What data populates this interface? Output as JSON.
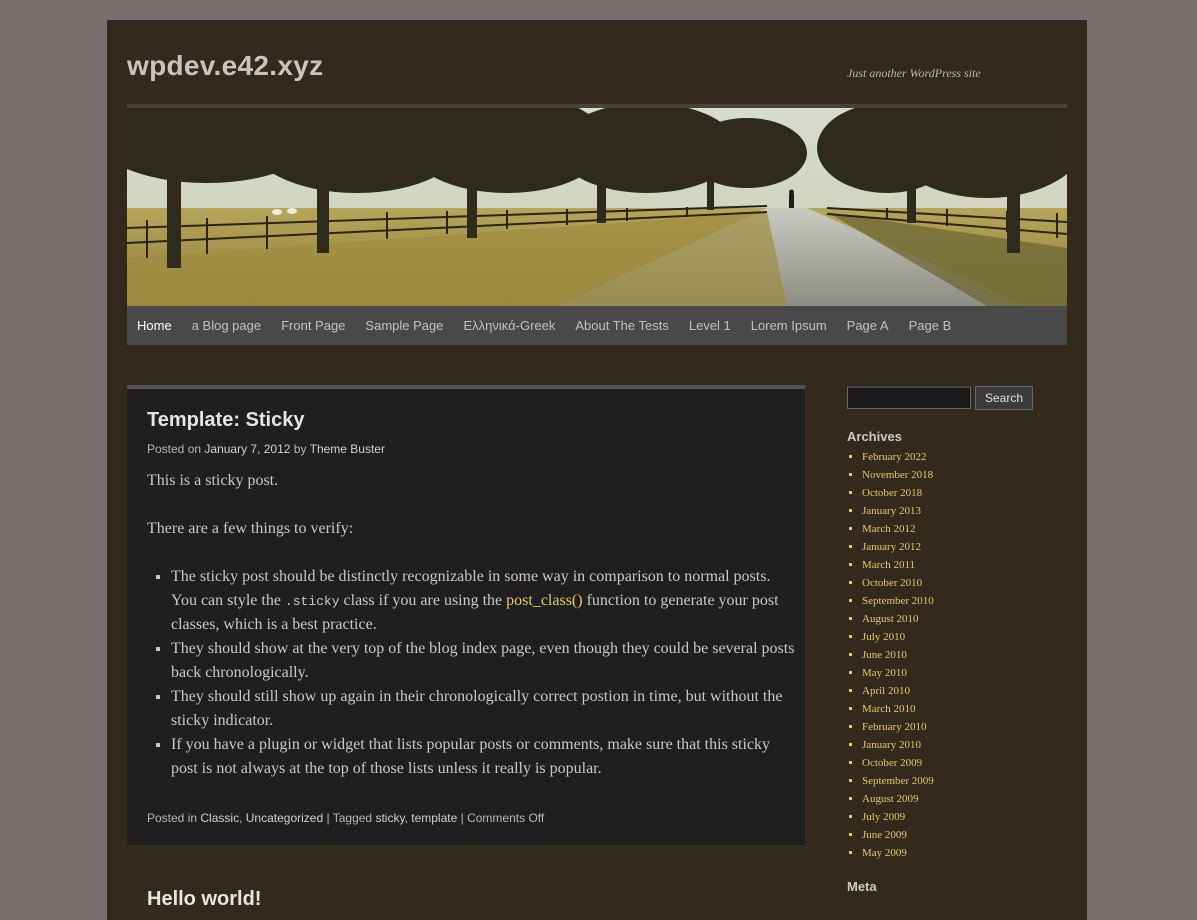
{
  "site": {
    "title": "wpdev.e42.xyz",
    "description": "Just another WordPress site"
  },
  "menu": [
    {
      "label": "Home",
      "current": true
    },
    {
      "label": "a Blog page"
    },
    {
      "label": "Front Page"
    },
    {
      "label": "Sample Page"
    },
    {
      "label": "Ελληνικά-Greek"
    },
    {
      "label": "About The Tests"
    },
    {
      "label": "Level 1"
    },
    {
      "label": "Lorem Ipsum"
    },
    {
      "label": "Page A"
    },
    {
      "label": "Page B"
    }
  ],
  "post": {
    "title": "Template: Sticky",
    "meta": {
      "posted_on": "Posted on",
      "date": "January 7, 2012",
      "by": "by",
      "author": "Theme Buster"
    },
    "paragraphs": [
      "This is a sticky post.",
      "There are a few things to verify:"
    ],
    "list": {
      "item1_a": "The sticky post should be distinctly recognizable in some way in comparison to normal posts. You can style the",
      "item1_code": ".sticky",
      "item1_b": "class if you are using the",
      "item1_link": "post_class()",
      "item1_c": "function to generate your post classes, which is a best practice.",
      "item2": "They should show at the very top of the blog index page, even though they could be several posts back chronologically.",
      "item3": "They should still show up again in their chronologically correct postion in time, but without the sticky indicator.",
      "item4": "If you have a plugin or widget that lists popular posts or comments, make sure that this sticky post is not always at the top of those lists unless it really is popular."
    },
    "footer": {
      "posted_in": "Posted in",
      "cat1": "Classic",
      "comma1": ",",
      "cat2": "Uncategorized",
      "sep1": "|",
      "tagged": "Tagged",
      "tag1": "sticky",
      "comma2": ",",
      "tag2": "template",
      "sep2": "|",
      "comments": "Comments Off"
    }
  },
  "next_post_title": "Hello world!",
  "sidebar": {
    "search_button": "Search",
    "archives_title": "Archives",
    "archives": [
      "February 2022",
      "November 2018",
      "October 2018",
      "January 2013",
      "March 2012",
      "January 2012",
      "March 2011",
      "October 2010",
      "September 2010",
      "August 2010",
      "July 2010",
      "June 2010",
      "May 2010",
      "April 2010",
      "March 2010",
      "February 2010",
      "January 2010",
      "October 2009",
      "September 2009",
      "August 2009",
      "July 2009",
      "June 2009",
      "May 2009"
    ],
    "meta_title": "Meta"
  },
  "colors": {
    "background": "#7a6e6e",
    "wrapper": "#33291d",
    "post_bg": "#1f1f1f",
    "link": "#e8c96a",
    "menu_bg": "#4a4949"
  }
}
